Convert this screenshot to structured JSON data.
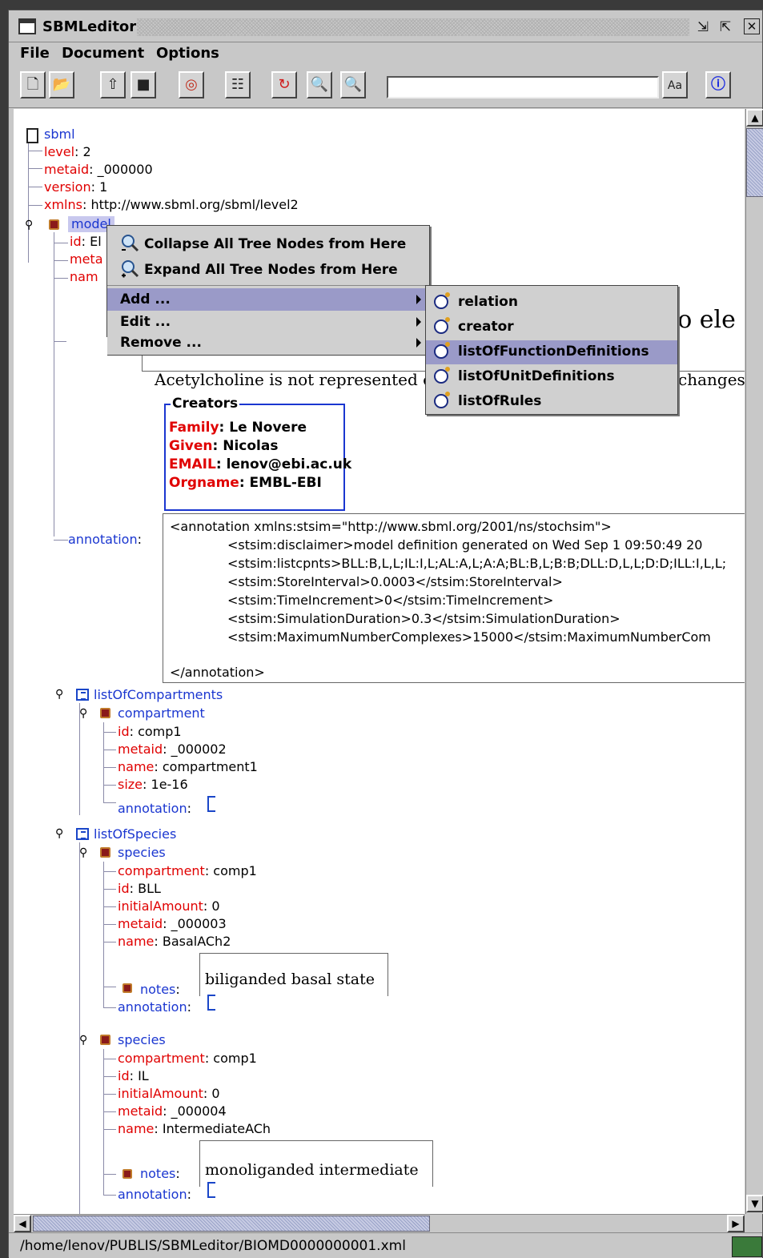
{
  "window": {
    "title": "SBMLeditor",
    "controls": [
      "minimize",
      "maximize",
      "close"
    ]
  },
  "menubar": {
    "file": "File",
    "document": "Document",
    "options": "Options"
  },
  "toolbar": {
    "buttons": [
      "new-document-icon",
      "open-folder-icon",
      "import-icon",
      "save-icon",
      "validate-icon",
      "properties-icon",
      "refresh-icon",
      "zoom-in-icon",
      "zoom-out-icon",
      "find-text-icon",
      "info-icon"
    ],
    "search_value": ""
  },
  "tree": {
    "root": "sbml",
    "root_attrs": [
      {
        "k": "level",
        "v": " 2"
      },
      {
        "k": "metaid",
        "v": " _000000"
      },
      {
        "k": "version",
        "v": " 1"
      },
      {
        "k": "xmlns",
        "v": " http://www.sbml.org/sbml/level2"
      }
    ],
    "model": "model",
    "model_attrs": [
      {
        "k": "id",
        "v": " El"
      },
      {
        "k": "meta",
        "v": ""
      },
      {
        "k": "nam",
        "v": ""
      }
    ],
    "notes_heading_fragment": "do ele",
    "notes_paragraph": "Acetylcholine is not represented e",
    "notes_paragraph_tail": "changes t",
    "creators": {
      "title": "Creators",
      "family_k": "Family",
      "family_v": ": Le Novere",
      "given_k": "Given",
      "given_v": ": Nicolas",
      "email_k": "EMAIL",
      "email_v": ": lenov@ebi.ac.uk",
      "orgname_k": "Orgname",
      "orgname_v": ": EMBL-EBI"
    },
    "annotation_label": "annotation",
    "annotation_lines": [
      "<annotation xmlns:stsim=\"http://www.sbml.org/2001/ns/stochsim\">",
      "<stsim:disclaimer>model definition generated on Wed Sep  1 09:50:49 20",
      "<stsim:listcpnts>BLL:B,L,L;IL:I,L;AL:A,L;A:A;BL:B,L;B:B;DLL:D,L,L;D:D;ILL:I,L,L;",
      "<stsim:StoreInterval>0.0003</stsim:StoreInterval>",
      "<stsim:TimeIncrement>0</stsim:TimeIncrement>",
      "<stsim:SimulationDuration>0.3</stsim:SimulationDuration>",
      "<stsim:MaximumNumberComplexes>15000</stsim:MaximumNumberCom",
      "",
      "</annotation>"
    ],
    "list_compartments": "listOfCompartments",
    "compartment": {
      "label": "compartment",
      "attrs": [
        {
          "k": "id",
          "v": " comp1"
        },
        {
          "k": "metaid",
          "v": " _000002"
        },
        {
          "k": "name",
          "v": " compartment1"
        },
        {
          "k": "size",
          "v": " 1e-16"
        }
      ],
      "annotation": "annotation"
    },
    "list_species": "listOfSpecies",
    "species1": {
      "label": "species",
      "attrs": [
        {
          "k": "compartment",
          "v": " comp1"
        },
        {
          "k": "id",
          "v": " BLL"
        },
        {
          "k": "initialAmount",
          "v": " 0"
        },
        {
          "k": "metaid",
          "v": " _000003"
        },
        {
          "k": "name",
          "v": " BasalACh2"
        }
      ],
      "notes_label": "notes",
      "notes_text": "biliganded basal state",
      "annotation": "annotation"
    },
    "species2": {
      "label": "species",
      "attrs": [
        {
          "k": "compartment",
          "v": " comp1"
        },
        {
          "k": "id",
          "v": " IL"
        },
        {
          "k": "initialAmount",
          "v": " 0"
        },
        {
          "k": "metaid",
          "v": " _000004"
        },
        {
          "k": "name",
          "v": " IntermediateACh"
        }
      ],
      "notes_label": "notes",
      "notes_text": "monoliganded intermediate",
      "annotation": "annotation"
    }
  },
  "context_menu": {
    "collapse": "Collapse All Tree Nodes from Here",
    "expand": "Expand All Tree Nodes from Here",
    "add": "Add ...",
    "edit": "Edit ...",
    "remove": "Remove ..."
  },
  "submenu": {
    "items": [
      "relation",
      "creator",
      "listOfFunctionDefinitions",
      "listOfUnitDefinitions",
      "listOfRules"
    ],
    "highlighted": "listOfFunctionDefinitions"
  },
  "status": {
    "path": "/home/lenov/PUBLIS/SBMLeditor/BIOMD0000000001.xml"
  },
  "colors": {
    "key": "#e00000",
    "node": "#1a36d0",
    "highlight": "#9a9ac8"
  }
}
